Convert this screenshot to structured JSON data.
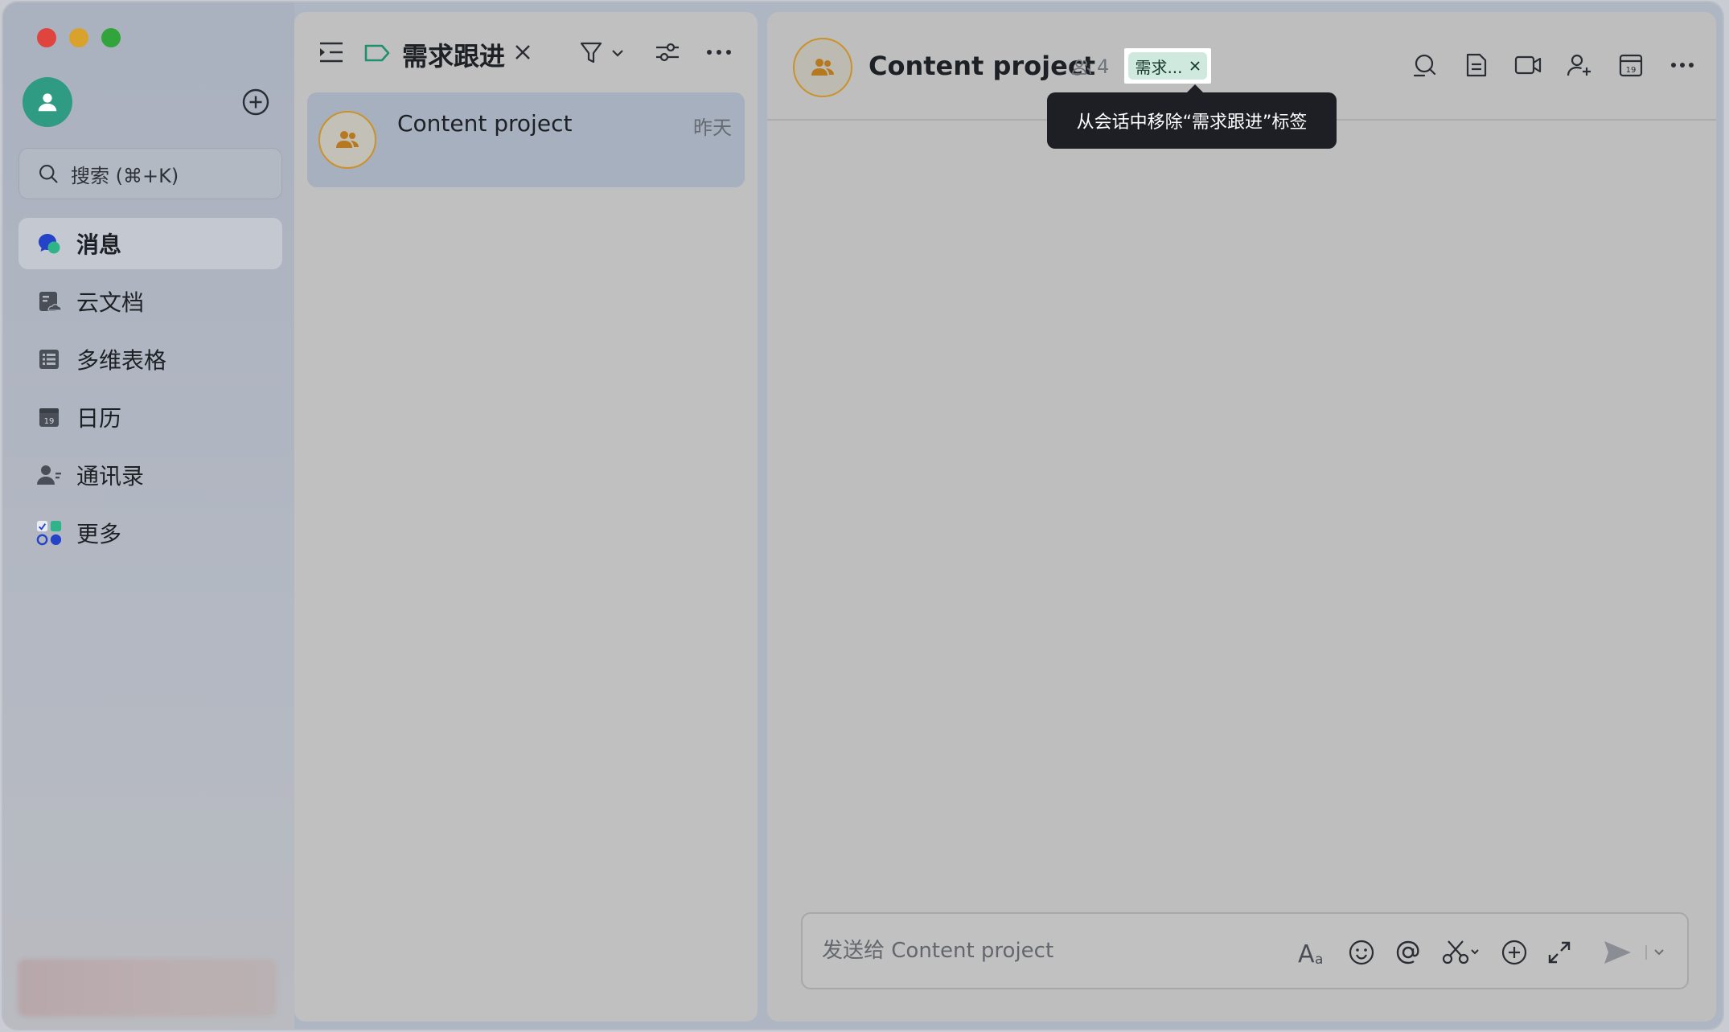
{
  "sidebar": {
    "search_placeholder": "搜索 (⌘+K)",
    "items": [
      {
        "label": "消息",
        "icon": "message-icon"
      },
      {
        "label": "云文档",
        "icon": "cloud-doc-icon"
      },
      {
        "label": "多维表格",
        "icon": "base-table-icon"
      },
      {
        "label": "日历",
        "icon": "calendar-icon"
      },
      {
        "label": "通讯录",
        "icon": "contacts-icon"
      },
      {
        "label": "更多",
        "icon": "more-apps-icon"
      }
    ],
    "active_index": 0,
    "calendar_day": "19"
  },
  "list": {
    "title": "需求跟进",
    "chats": [
      {
        "name": "Content project",
        "time": "昨天"
      }
    ]
  },
  "chat": {
    "title": "Content project",
    "member_count": "4",
    "tag_label": "需求...",
    "tooltip": "从会话中移除“需求跟进”标签",
    "composer_placeholder": "发送给 Content project",
    "calendar_day": "19"
  },
  "colors": {
    "accent_green": "#2e9b82",
    "group_avatar_ring": "#c9922a",
    "tag_bg": "#cfe9df"
  }
}
